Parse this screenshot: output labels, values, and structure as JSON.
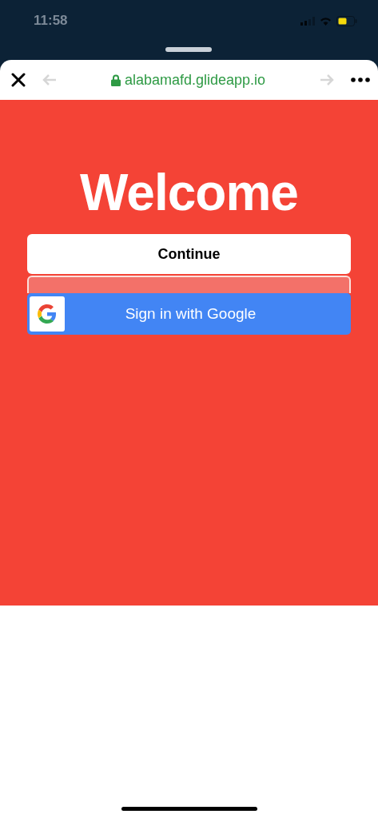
{
  "status_bar": {
    "time": "11:58"
  },
  "browser": {
    "url": "alabamafd.glideapp.io",
    "back_disabled": true,
    "forward_disabled": true
  },
  "welcome": {
    "title": "Welcome",
    "continue_button": "Continue",
    "google_button": "Sign in with Google"
  }
}
